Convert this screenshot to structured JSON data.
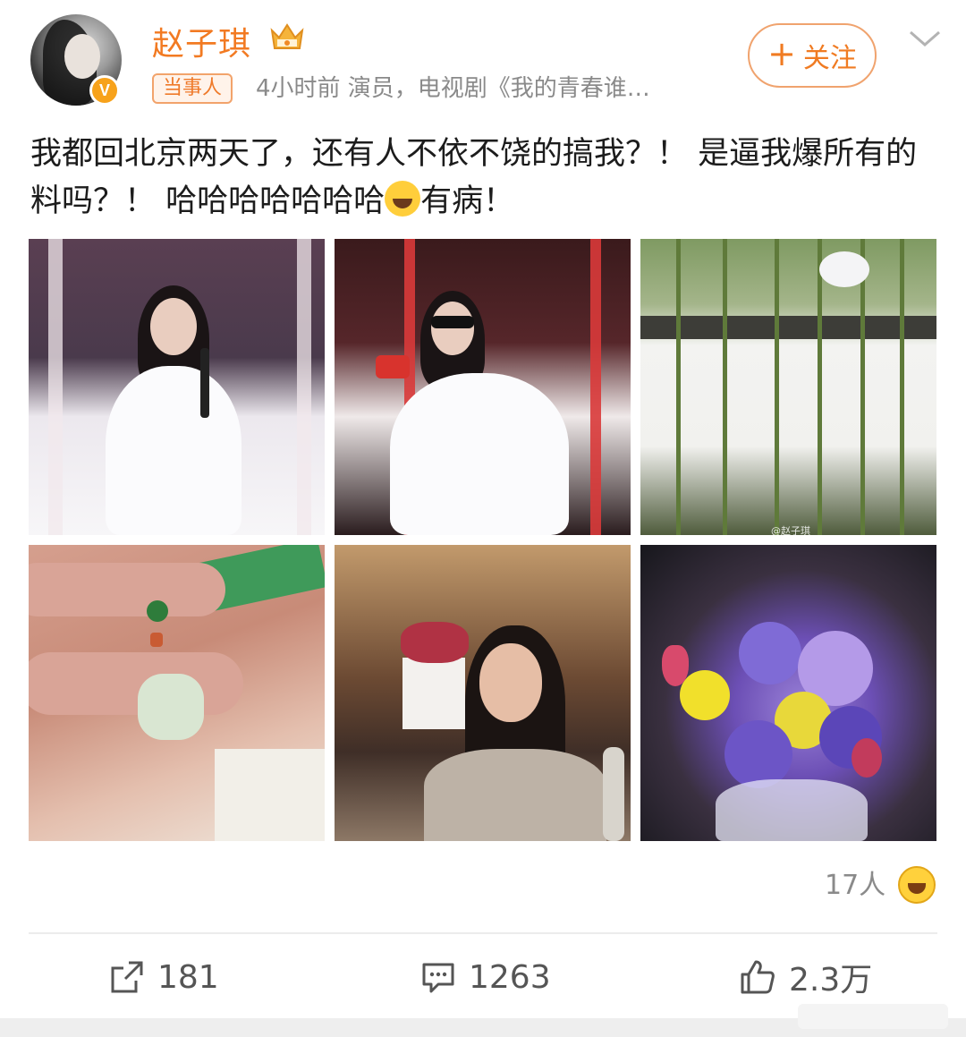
{
  "header": {
    "username": "赵子琪",
    "tag": "当事人",
    "meta": "4小时前   演员，电视剧《我的青春谁…",
    "follow_label": "关注",
    "verified_glyph": "V"
  },
  "post": {
    "text": "我都回北京两天了，还有人不依不饶的搞我？！ 是逼我爆所有的料吗？！ 哈哈哈哈哈哈哈",
    "text_tail": "有病！",
    "photos": [
      {
        "name": "stage-white-dress"
      },
      {
        "name": "stage-sunglasses"
      },
      {
        "name": "bamboo-courtyard",
        "watermark": "@赵子琪"
      },
      {
        "name": "jade-pendant"
      },
      {
        "name": "selfie-room"
      },
      {
        "name": "purple-flower-bouquet"
      }
    ]
  },
  "reactions": {
    "count_label": "17人"
  },
  "actions": {
    "repost_count": "181",
    "comment_count": "1263",
    "like_count": "2.3万"
  },
  "colors": {
    "accent": "#f27a22",
    "follow_border": "#f0a36e",
    "meta_gray": "#8a8a8a"
  },
  "icons": [
    "verified-badge-icon",
    "crown-icon",
    "chevron-down-icon",
    "laugh-cry-emoji-icon",
    "grin-emoji-icon",
    "repost-icon",
    "comment-icon",
    "like-icon"
  ]
}
